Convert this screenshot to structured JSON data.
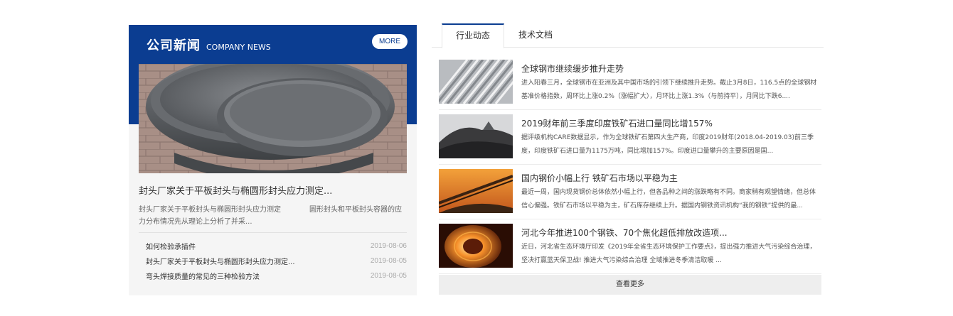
{
  "company_news": {
    "title_cn": "公司新闻",
    "title_en": "COMPANY NEWS",
    "more_label": "MORE",
    "feature": {
      "title": "封头厂家关于平板封头与椭圆形封头应力测定...",
      "summary": "封头厂家关于平板封头与椭圆形封头应力测定　　　　圆形封头和平板封头容器的应力分布情况先从理论上分析了并采..."
    },
    "list": [
      {
        "title": "如何检验承插件",
        "date": "2019-08-06"
      },
      {
        "title": "封头厂家关于平板封头与椭圆形封头应力测定...",
        "date": "2019-08-05"
      },
      {
        "title": "弯头焊接质量的常见的三种检验方法",
        "date": "2019-08-05"
      }
    ]
  },
  "industry": {
    "tabs": [
      {
        "label": "行业动态",
        "active": true
      },
      {
        "label": "技术文档",
        "active": false
      }
    ],
    "articles": [
      {
        "title": "全球钢市继续缓步推升走势",
        "desc": "进入阳春三月，全球钢市在亚洲及其中国市场的引领下继续推升走势。截止3月8日，116.5点的全球钢材基准价格指数，周环比上涨0.2%（涨幅扩大），月环比上涨1.3%（与前持平），月同比下跌6...."
      },
      {
        "title": "2019财年前三季度印度铁矿石进口量同比增157%",
        "desc": "据评级机构CARE数据显示，作为全球铁矿石第四大生产商，印度2019财年(2018.04-2019.03)前三季度，印度铁矿石进口量为1175万吨，同比增加157%。印度进口量攀升的主要原因是国..."
      },
      {
        "title": "国内钢价小幅上行 铁矿石市场以平稳为主",
        "desc": "最近一周，国内现货钢价总体依然小幅上行，但各品种之间的涨跌略有不同。商家稍有观望情绪，但总体信心偏强。铁矿石市场以平稳为主，矿石库存继续上升。据国内钢铁资讯机构“我的钢铁”提供的最..."
      },
      {
        "title": "河北今年推进100个钢铁、70个焦化超低排放改造项...",
        "desc": "近日，河北省生态环境厅印发《2019年全省生态环境保护工作要点》，提出强力推进大气污染综合治理，坚决打赢蓝天保卫战! 推进大气污染综合治理 全域推进冬季清洁取暖 ..."
      }
    ],
    "see_more": "查看更多"
  }
}
